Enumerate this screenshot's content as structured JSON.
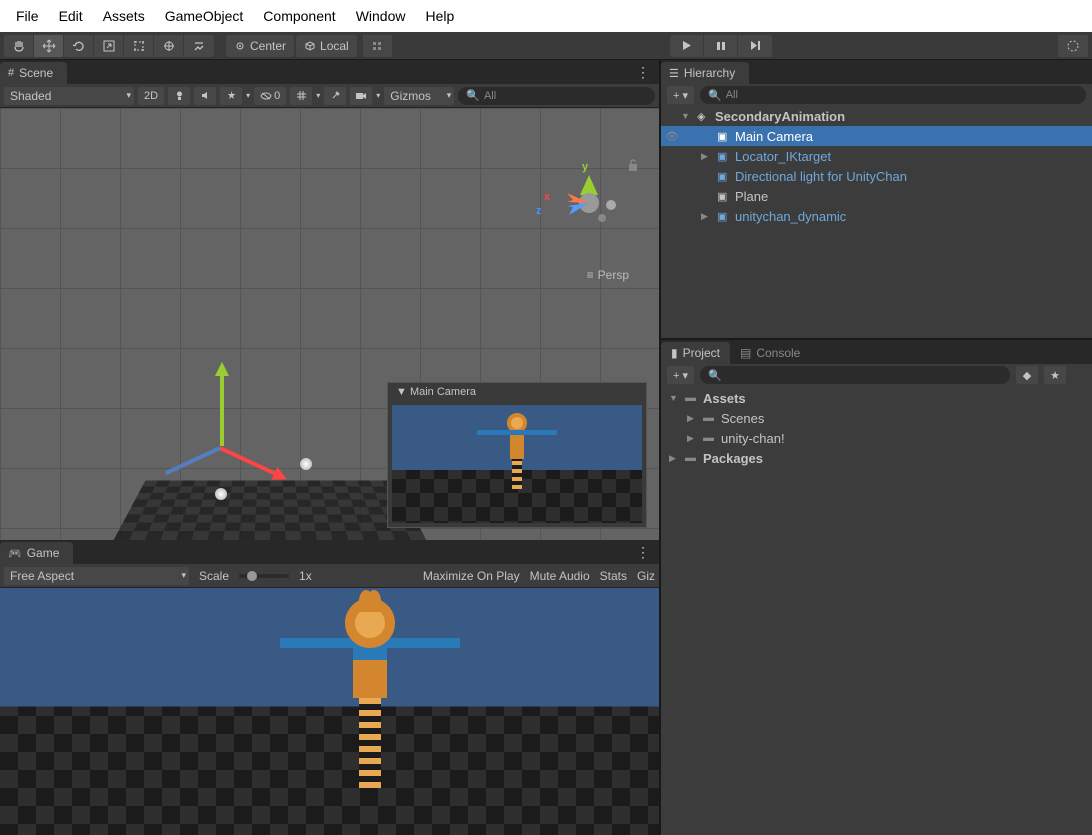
{
  "menubar": {
    "items": [
      "File",
      "Edit",
      "Assets",
      "GameObject",
      "Component",
      "Window",
      "Help"
    ]
  },
  "toolbar": {
    "pivot": "Center",
    "space": "Local"
  },
  "scene": {
    "tab": "Scene",
    "shading": "Shaded",
    "mode2d": "2D",
    "zero": "0",
    "gizmos": "Gizmos",
    "persp": "Persp",
    "search_placeholder": "All",
    "axes": {
      "x": "x",
      "y": "y",
      "z": "z"
    },
    "preview_title": "Main Camera"
  },
  "game": {
    "tab": "Game",
    "aspect": "Free Aspect",
    "scale_label": "Scale",
    "scale_value": "1x",
    "maximize": "Maximize On Play",
    "mute": "Mute Audio",
    "stats": "Stats",
    "giz": "Giz"
  },
  "hierarchy": {
    "tab": "Hierarchy",
    "search_placeholder": "All",
    "items": [
      {
        "name": "SecondaryAnimation",
        "depth": 0,
        "expanded": true,
        "root": true,
        "unity": true
      },
      {
        "name": "Main Camera",
        "depth": 1,
        "selected": true,
        "eye": true
      },
      {
        "name": "Locator_IKtarget",
        "depth": 1,
        "expandable": true,
        "prefab": true
      },
      {
        "name": "Directional light for UnityChan",
        "depth": 1,
        "prefab": true
      },
      {
        "name": "Plane",
        "depth": 1
      },
      {
        "name": "unitychan_dynamic",
        "depth": 1,
        "expandable": true,
        "prefab": true
      }
    ]
  },
  "project": {
    "tab_project": "Project",
    "tab_console": "Console",
    "items": [
      {
        "name": "Assets",
        "depth": 0,
        "expanded": true,
        "bold": true
      },
      {
        "name": "Scenes",
        "depth": 1,
        "expandable": true
      },
      {
        "name": "unity-chan!",
        "depth": 1,
        "expandable": true
      },
      {
        "name": "Packages",
        "depth": 0,
        "expandable": true,
        "bold": true
      }
    ]
  }
}
